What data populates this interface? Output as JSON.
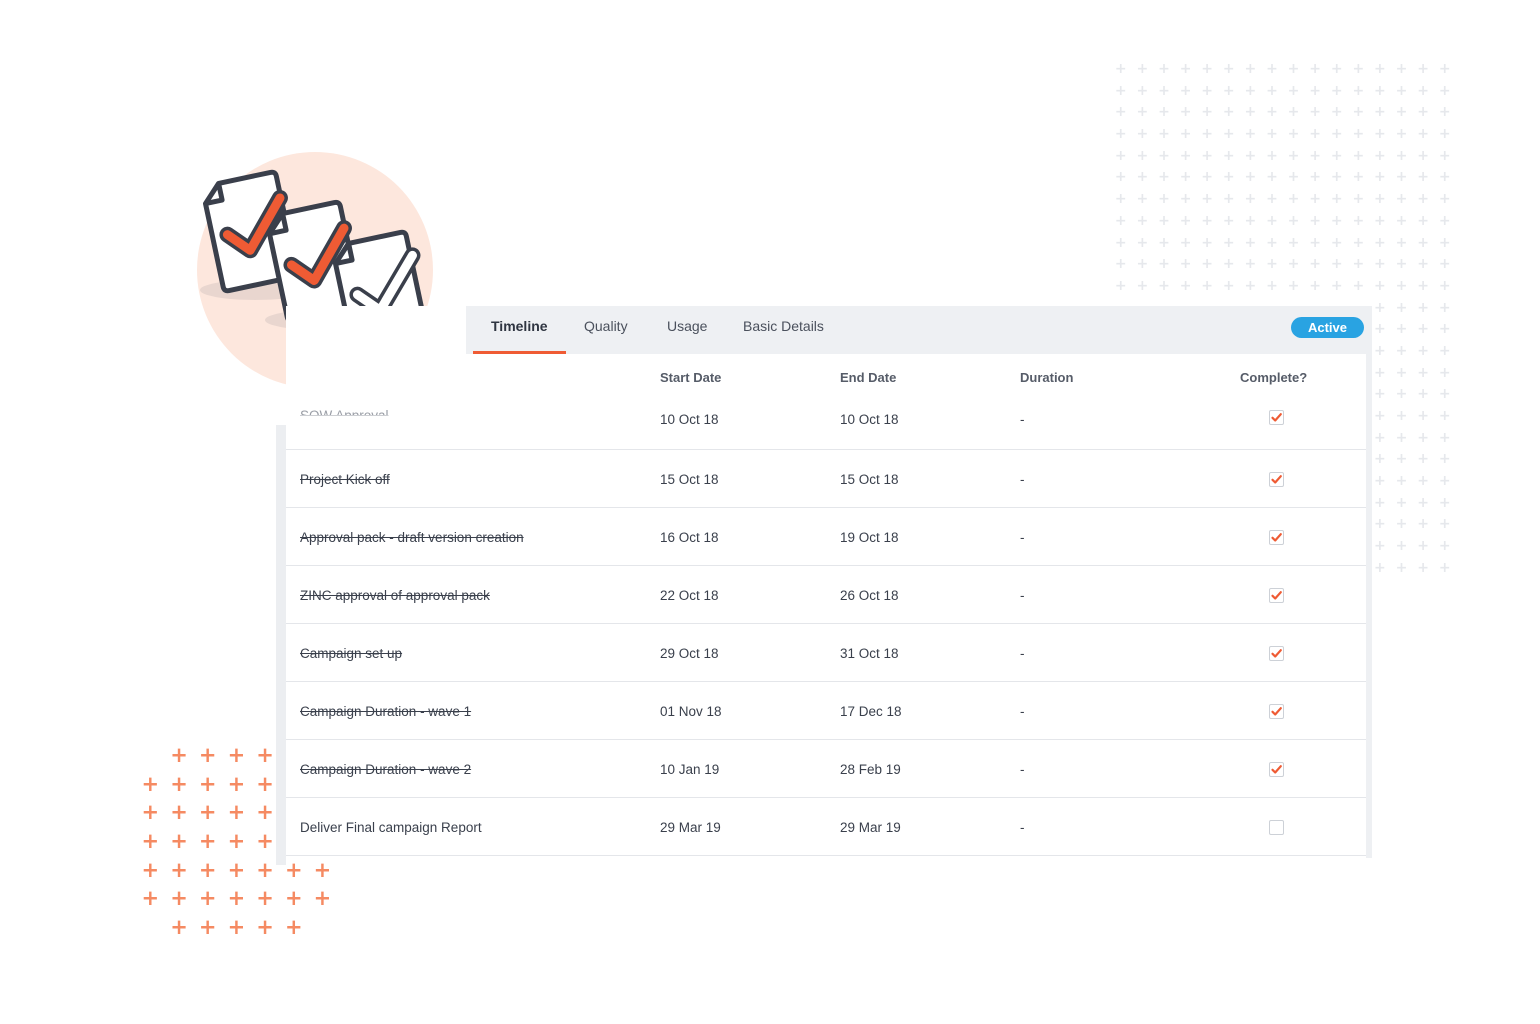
{
  "tabs": [
    {
      "label": "Timeline",
      "active": true
    },
    {
      "label": "Quality",
      "active": false
    },
    {
      "label": "Usage",
      "active": false
    },
    {
      "label": "Basic Details",
      "active": false
    }
  ],
  "status_badge": "Active",
  "columns": {
    "start_date": "Start Date",
    "end_date": "End Date",
    "duration": "Duration",
    "complete": "Complete?"
  },
  "rows": [
    {
      "task": "SOW Approval",
      "start": "10 Oct 18",
      "end": "10 Oct 18",
      "duration": "-",
      "complete": true
    },
    {
      "task": "Project Kick off",
      "start": "15 Oct 18",
      "end": "15 Oct 18",
      "duration": "-",
      "complete": true
    },
    {
      "task": "Approval pack - draft version creation",
      "start": "16 Oct 18",
      "end": "19 Oct 18",
      "duration": "-",
      "complete": true
    },
    {
      "task": "ZINC approval of approval pack",
      "start": "22 Oct 18",
      "end": "26 Oct 18",
      "duration": "-",
      "complete": true
    },
    {
      "task": "Campaign set up",
      "start": "29 Oct 18",
      "end": "31 Oct 18",
      "duration": "-",
      "complete": true
    },
    {
      "task": "Campaign Duration - wave 1",
      "start": "01 Nov 18",
      "end": "17 Dec 18",
      "duration": "-",
      "complete": true
    },
    {
      "task": "Campaign Duration - wave 2",
      "start": "10 Jan 19",
      "end": "28 Feb 19",
      "duration": "-",
      "complete": true
    },
    {
      "task": "Deliver Final campaign Report",
      "start": "29 Mar 19",
      "end": "29 Mar 19",
      "duration": "-",
      "complete": false
    }
  ],
  "colors": {
    "accent": "#ef5b34",
    "badge": "#29a3e2",
    "hero_circle": "#fde7dd"
  },
  "icons": [
    "checklist-documents-icon",
    "checkbox-checked-icon",
    "checkbox-empty-icon"
  ]
}
